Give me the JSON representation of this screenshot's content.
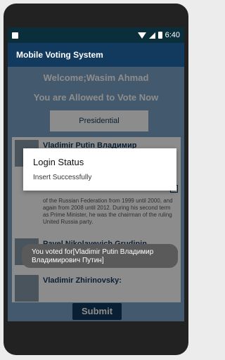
{
  "statusbar": {
    "time": "6:40"
  },
  "appbar": {
    "title": "Mobile Voting System"
  },
  "main": {
    "welcome": "Welcome;Wasim Ahmad",
    "allowed": "You are Allowed to Vote Now",
    "category_button": "Presidential",
    "candidates": [
      {
        "name": "Vladimir Putin Владимир Владимирович Путин",
        "description": "of the Russian Federation from 1999 until 2000, and again from 2008 until 2012. During his second term as Prime Minister, he was the chairman of the ruling United Russia party."
      },
      {
        "name": "Pavel Nikolayevich Grudinin",
        "description": ""
      },
      {
        "name": "Vladimir Zhirinovsky:",
        "description": ""
      }
    ],
    "submit_label": "Submit"
  },
  "dialog": {
    "title": "Login Status",
    "message": "Insert Successfully"
  },
  "toast": {
    "message": "You voted for[Vladimir Putin Владимир Владимирович Путин]"
  },
  "colors": {
    "appbar": "#123a5f",
    "content_bg": "#7aa3c6"
  }
}
